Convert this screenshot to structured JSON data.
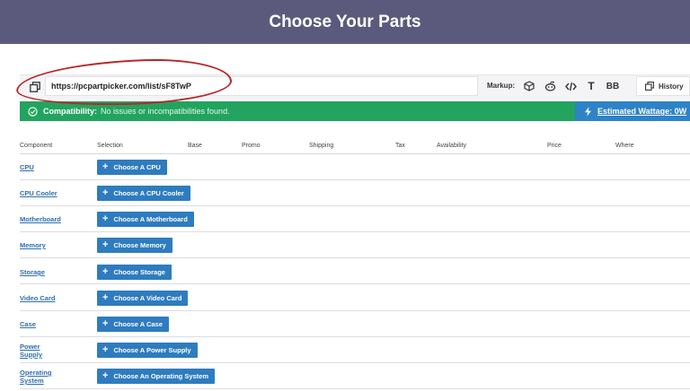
{
  "header": {
    "title": "Choose Your Parts"
  },
  "urlbar": {
    "url": "https://pcpartpicker.com/list/sF8TwP",
    "markup_label": "Markup:",
    "markup_text_icon": "T",
    "markup_bb_icon": "BB",
    "history_label": "History"
  },
  "compat": {
    "label": "Compatibility:",
    "message": "No issues or incompatibilities found.",
    "wattage": "Estimated Wattage: 0W"
  },
  "columns": [
    "Component",
    "Selection",
    "Base",
    "Promo",
    "Shipping",
    "Tax",
    "Availability",
    "Price",
    "Where"
  ],
  "rows": [
    {
      "component": "CPU",
      "button": "Choose A CPU"
    },
    {
      "component": "CPU Cooler",
      "button": "Choose A CPU Cooler"
    },
    {
      "component": "Motherboard",
      "button": "Choose A Motherboard"
    },
    {
      "component": "Memory",
      "button": "Choose Memory"
    },
    {
      "component": "Storage",
      "button": "Choose Storage"
    },
    {
      "component": "Video Card",
      "button": "Choose A Video Card"
    },
    {
      "component": "Case",
      "button": "Choose A Case"
    },
    {
      "component": "Power Supply",
      "button": "Choose A Power Supply"
    },
    {
      "component": "Operating System",
      "button": "Choose An Operating System"
    }
  ],
  "colors": {
    "header": "#5c5a7c",
    "success": "#22a45f",
    "accent": "#2e7cbf",
    "link": "#2e6fb0",
    "annotation": "#b8262a"
  },
  "icons": [
    "copy-icon",
    "box-icon",
    "reddit-icon",
    "code-icon",
    "text-icon",
    "bb-icon",
    "history-icon",
    "check-circle-icon",
    "bolt-icon",
    "plus-icon"
  ]
}
